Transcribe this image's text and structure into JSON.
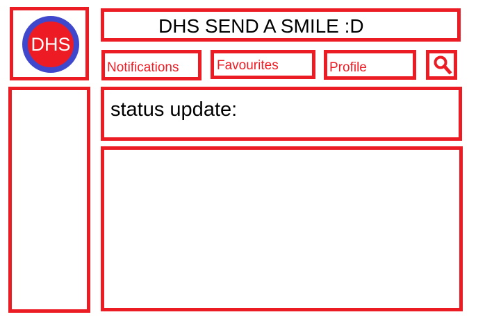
{
  "logo": {
    "text": "DHS",
    "fill_color": "#ed1c24",
    "ring_color": "#3f48cc"
  },
  "header": {
    "title": "DHS SEND A SMILE :D"
  },
  "nav": {
    "notifications_label": "Notifications",
    "favourites_label": "Favourites",
    "profile_label": "Profile",
    "search_icon": "search-icon"
  },
  "status": {
    "label": "status update:"
  },
  "colors": {
    "border": "#ec1c24",
    "nav_text": "#ec1c24",
    "text": "#000000"
  }
}
